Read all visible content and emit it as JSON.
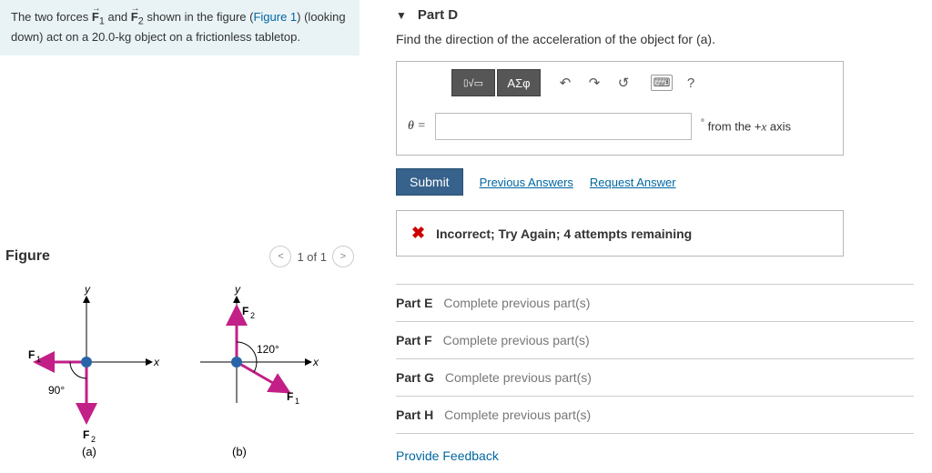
{
  "problem": {
    "text_pre": "The two forces ",
    "f1": "F",
    "sub1": "1",
    "text_mid1": " and ",
    "f2": "F",
    "sub2": "2",
    "text_mid2": " shown in the figure (",
    "fig_link": "Figure 1",
    "text_post": ") (looking down) act on a 20.0-kg object on a frictionless tabletop."
  },
  "figure": {
    "title": "Figure",
    "pager": "1 of 1",
    "sub_a": "(a)",
    "sub_b": "(b)",
    "angle_a": "90°",
    "angle_b": "120°",
    "axis_x": "x",
    "axis_y": "y",
    "Flabel1": "F",
    "Fsub1": "1",
    "Flabel2": "F",
    "Fsub2": "2"
  },
  "partD": {
    "caret": "▼",
    "title": "Part D",
    "prompt": "Find the direction of the acceleration of the object for (a).",
    "toolbar": {
      "templates_icon": "▭",
      "sqrt_icon": "√▭",
      "greek": "ΑΣφ",
      "undo": "↶",
      "redo": "↷",
      "reset": "↺",
      "keyboard": "⌨",
      "help": "?"
    },
    "theta_lhs": "θ =",
    "unit_suffix_deg": "°",
    "unit_suffix_text": " from the +",
    "unit_suffix_x": "x",
    "unit_suffix_axis": " axis",
    "submit": "Submit",
    "prev_ans": "Previous Answers",
    "req_ans": "Request Answer",
    "feedback": "Incorrect; Try Again; 4 attempts remaining"
  },
  "other_parts": [
    {
      "label": "Part E",
      "text": "Complete previous part(s)"
    },
    {
      "label": "Part F",
      "text": "Complete previous part(s)"
    },
    {
      "label": "Part G",
      "text": "Complete previous part(s)"
    },
    {
      "label": "Part H",
      "text": "Complete previous part(s)"
    }
  ],
  "provide_feedback": "Provide Feedback"
}
